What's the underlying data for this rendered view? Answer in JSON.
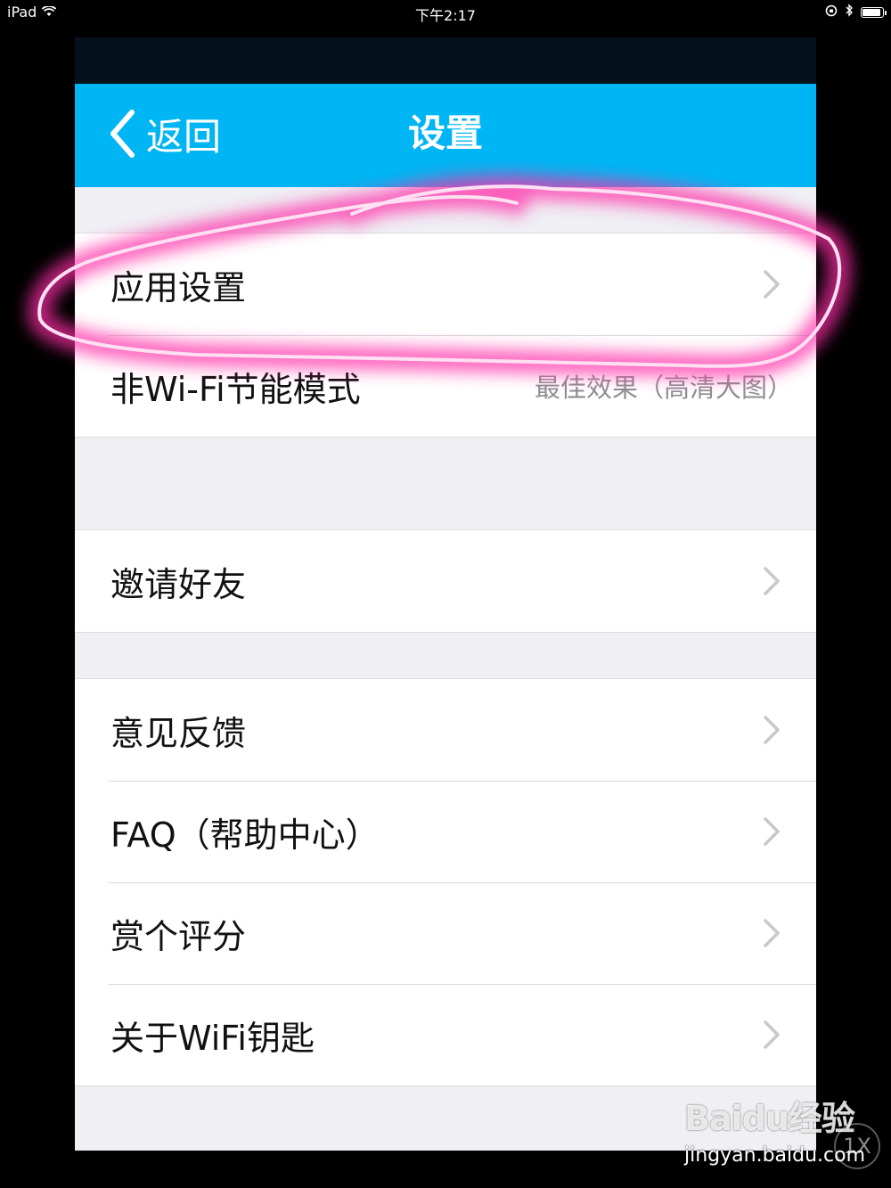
{
  "status_bar": {
    "device": "iPad",
    "time": "下午2:17",
    "battery_level": 0.85
  },
  "nav": {
    "back_label": "返回",
    "title": "设置"
  },
  "groups": [
    {
      "rows": [
        {
          "label": "应用设置",
          "detail": "",
          "chevron": true,
          "highlighted": true
        },
        {
          "label": "非Wi-Fi节能模式",
          "detail": "最佳效果（高清大图）",
          "chevron": false
        }
      ]
    },
    {
      "rows": [
        {
          "label": "邀请好友",
          "detail": "",
          "chevron": true
        }
      ]
    },
    {
      "rows": [
        {
          "label": "意见反馈",
          "detail": "",
          "chevron": true
        },
        {
          "label": "FAQ（帮助中心）",
          "detail": "",
          "chevron": true
        },
        {
          "label": "赏个评分",
          "detail": "",
          "chevron": true
        },
        {
          "label": "关于WiFi钥匙",
          "detail": "",
          "chevron": true
        }
      ]
    }
  ],
  "watermark": {
    "logo": "Baidu经验",
    "url": "jingyan.baidu.com",
    "badge": "1X"
  },
  "colors": {
    "nav_blue": "#00b5f3",
    "annotation_pink": "#ff2ea8",
    "background_gray": "#efeff4"
  }
}
